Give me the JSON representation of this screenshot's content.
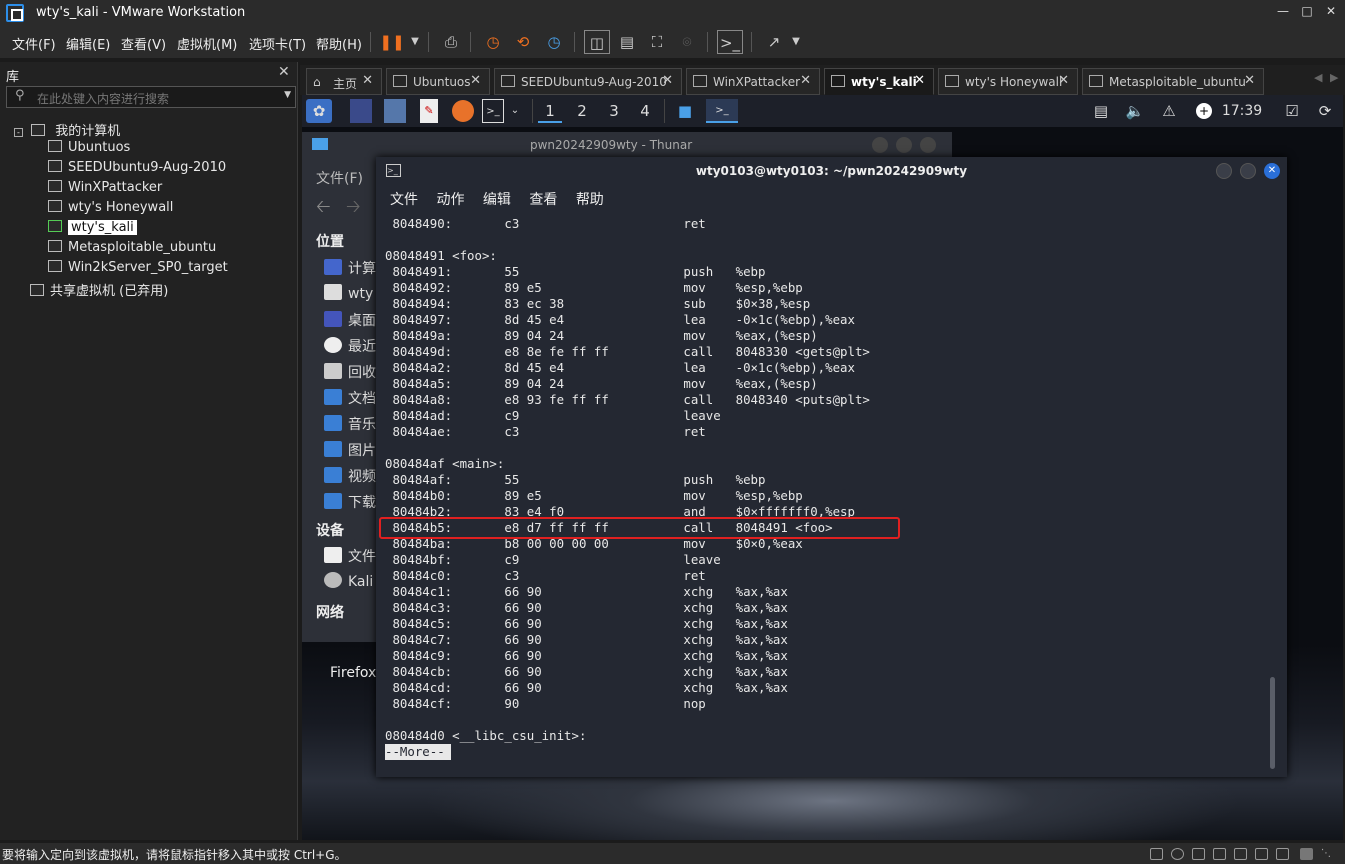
{
  "window": {
    "title": "wty's_kali - VMware Workstation"
  },
  "menubar": {
    "items": [
      "文件(F)",
      "编辑(E)",
      "查看(V)",
      "虚拟机(M)",
      "选项卡(T)",
      "帮助(H)"
    ]
  },
  "library": {
    "title": "库",
    "search_placeholder": "在此处键入内容进行搜索",
    "root": "我的计算机",
    "vms": [
      "Ubuntuos",
      "SEEDUbuntu9-Aug-2010",
      "WinXPattacker",
      "wty's Honeywall",
      "wty's_kali",
      "Metasploitable_ubuntu",
      "Win2kServer_SP0_target"
    ],
    "shared": "共享虚拟机 (已弃用)"
  },
  "tabs": [
    "主页",
    "Ubuntuos",
    "SEEDUbuntu9-Aug-2010",
    "WinXPattacker",
    "wty's_kali",
    "wty's Honeywall",
    "Metasploitable_ubuntu"
  ],
  "kali_panel": {
    "workspaces": [
      "1",
      "2",
      "3",
      "4"
    ],
    "clock": "17:39"
  },
  "thunar": {
    "title": "pwn20242909wty - Thunar",
    "menu": "文件(F)",
    "places_header": "位置",
    "places": [
      "计算",
      "wty",
      "桌面",
      "最近",
      "回收",
      "文档",
      "音乐",
      "图片",
      "视频",
      "下载"
    ],
    "devices_header": "设备",
    "devices": [
      "文件",
      "Kali"
    ],
    "network_header": "网络",
    "desktop_label": "Firefox"
  },
  "terminal": {
    "title": "wty0103@wty0103: ~/pwn20242909wty",
    "menu": [
      "文件",
      "动作",
      "编辑",
      "查看",
      "帮助"
    ],
    "lines": [
      " 8048490:       c3                      ret",
      "",
      "08048491 <foo>:",
      " 8048491:       55                      push   %ebp",
      " 8048492:       89 e5                   mov    %esp,%ebp",
      " 8048494:       83 ec 38                sub    $0×38,%esp",
      " 8048497:       8d 45 e4                lea    -0×1c(%ebp),%eax",
      " 804849a:       89 04 24                mov    %eax,(%esp)",
      " 804849d:       e8 8e fe ff ff          call   8048330 <gets@plt>",
      " 80484a2:       8d 45 e4                lea    -0×1c(%ebp),%eax",
      " 80484a5:       89 04 24                mov    %eax,(%esp)",
      " 80484a8:       e8 93 fe ff ff          call   8048340 <puts@plt>",
      " 80484ad:       c9                      leave",
      " 80484ae:       c3                      ret",
      "",
      "080484af <main>:",
      " 80484af:       55                      push   %ebp",
      " 80484b0:       89 e5                   mov    %esp,%ebp",
      " 80484b2:       83 e4 f0                and    $0×fffffff0,%esp",
      " 80484b5:       e8 d7 ff ff ff          call   8048491 <foo>",
      " 80484ba:       b8 00 00 00 00          mov    $0×0,%eax",
      " 80484bf:       c9                      leave",
      " 80484c0:       c3                      ret",
      " 80484c1:       66 90                   xchg   %ax,%ax",
      " 80484c3:       66 90                   xchg   %ax,%ax",
      " 80484c5:       66 90                   xchg   %ax,%ax",
      " 80484c7:       66 90                   xchg   %ax,%ax",
      " 80484c9:       66 90                   xchg   %ax,%ax",
      " 80484cb:       66 90                   xchg   %ax,%ax",
      " 80484cd:       66 90                   xchg   %ax,%ax",
      " 80484cf:       90                      nop",
      "",
      "080484d0 <__libc_csu_init>:"
    ],
    "pager": "--More--"
  },
  "statusbar": {
    "text": "要将输入定向到该虚拟机，请将鼠标指针移入其中或按 Ctrl+G。"
  },
  "colors": {
    "highlight": "#e02020",
    "accent": "#2d8ee8",
    "pause": "#f07020"
  }
}
